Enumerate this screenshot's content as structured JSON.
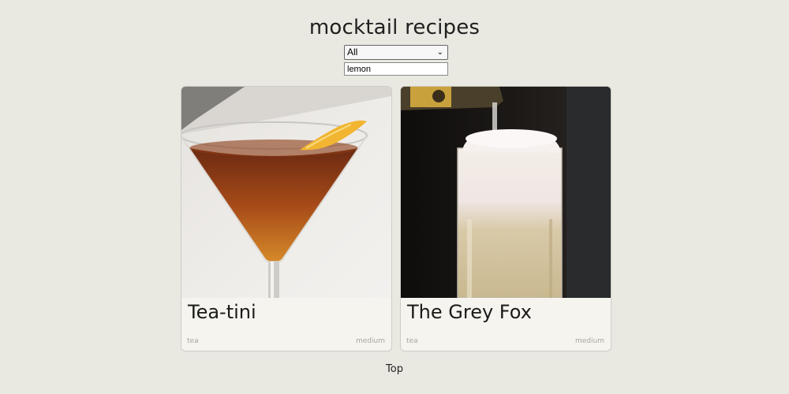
{
  "page": {
    "title": "mocktail recipes",
    "filter_select": {
      "value": "All"
    },
    "search_input": {
      "value": "lemon"
    },
    "top_link": "Top"
  },
  "recipes": [
    {
      "title": "Tea-tini",
      "category": "tea",
      "difficulty": "medium",
      "image_icon": "martini-glass-photo"
    },
    {
      "title": "The Grey Fox",
      "category": "tea",
      "difficulty": "medium",
      "image_icon": "foamy-drink-photo"
    }
  ],
  "colors": {
    "background": "#e9e8e1",
    "card_background": "#f5f4ee",
    "muted_text": "#a7a69f"
  }
}
